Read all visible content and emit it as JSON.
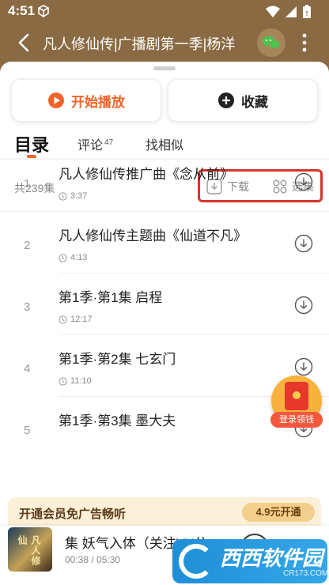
{
  "status": {
    "time": "4:51"
  },
  "header": {
    "title": "凡人修仙传|广播剧第一季|杨洋"
  },
  "actions": {
    "play_label": "开始播放",
    "favorite_label": "收藏"
  },
  "tabs": [
    {
      "label": "目录"
    },
    {
      "label": "评论",
      "badge": "47"
    },
    {
      "label": "找相似"
    }
  ],
  "toolbar": {
    "episode_count": "共239集",
    "download_label": "下载",
    "select_label": "选集"
  },
  "episodes": [
    {
      "index": "1",
      "title": "凡人修仙传推广曲《念从前》",
      "duration": "3:37"
    },
    {
      "index": "2",
      "title": "凡人修仙传主题曲《仙道不凡》",
      "duration": "4:13"
    },
    {
      "index": "3",
      "title": "第1季·第1集 启程",
      "duration": "12:17"
    },
    {
      "index": "4",
      "title": "第1季·第2集 七玄门",
      "duration": "11:10"
    },
    {
      "index": "5",
      "title": "第1季·第3集 墨大夫",
      "duration": ""
    }
  ],
  "red_packet": {
    "label": "登录领钱"
  },
  "vip_bar": {
    "text": "开通会员免广告畅听",
    "cta": "4.9元开通"
  },
  "player": {
    "cover_text": "凡人修仙",
    "title": "集 妖气入体（关注VX公",
    "time": "00:38 / 05:30"
  },
  "watermark": {
    "brand": "西西软件园",
    "site": "CR173.COM"
  },
  "colors": {
    "header_bg": "#8a6a42",
    "accent": "#f0642a",
    "highlight_border": "#d9332b"
  }
}
